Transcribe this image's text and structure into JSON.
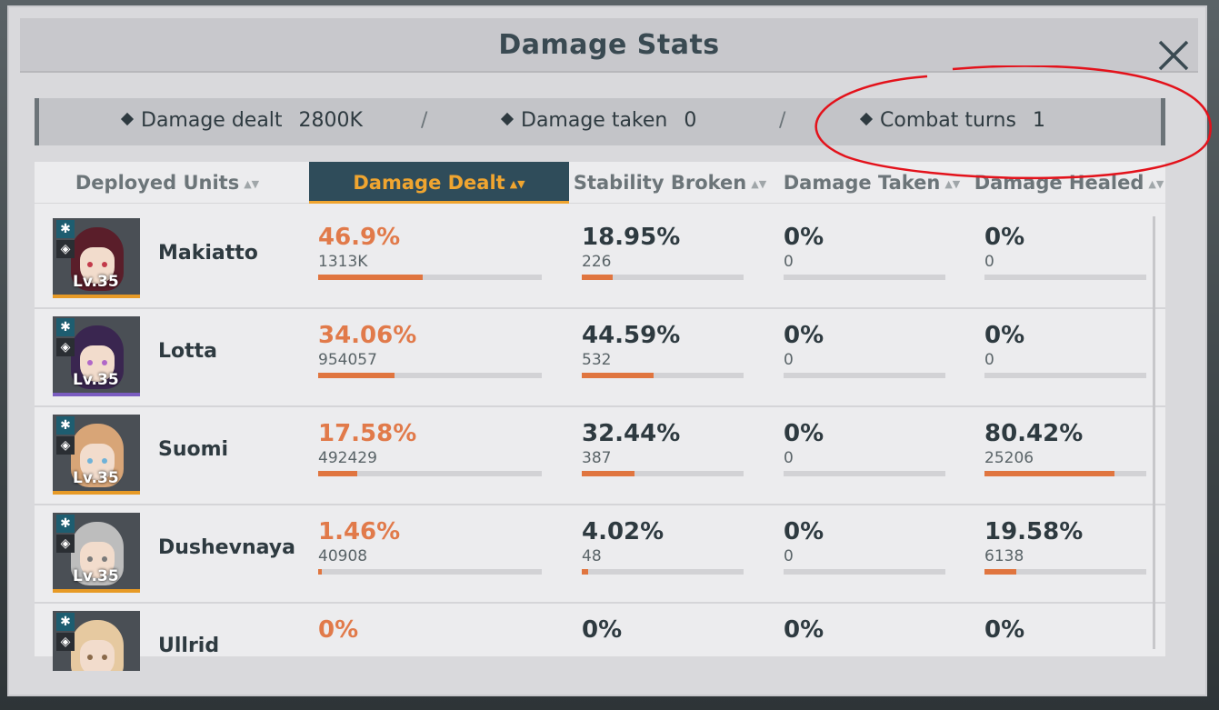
{
  "window": {
    "title": "Damage Stats",
    "close_icon": "close-icon"
  },
  "summary": {
    "items": [
      {
        "label": "Damage dealt",
        "value": "2800K"
      },
      {
        "label": "Damage taken",
        "value": "0"
      },
      {
        "label": "Combat turns",
        "value": "1"
      }
    ],
    "separator": "/"
  },
  "table": {
    "columns": [
      {
        "label": "Deployed Units",
        "active": false
      },
      {
        "label": "Damage Dealt",
        "active": true
      },
      {
        "label": "Stability Broken",
        "active": false
      },
      {
        "label": "Damage Taken",
        "active": false
      },
      {
        "label": "Damage Healed",
        "active": false
      }
    ],
    "rows": [
      {
        "name": "Makiatto",
        "level": "Lv.35",
        "dealt": {
          "pct": "46.9%",
          "raw": "1313K",
          "ratio": 0.469
        },
        "stability": {
          "pct": "18.95%",
          "raw": "226",
          "ratio": 0.1895
        },
        "taken": {
          "pct": "0%",
          "raw": "0",
          "ratio": 0
        },
        "healed": {
          "pct": "0%",
          "raw": "0",
          "ratio": 0
        }
      },
      {
        "name": "Lotta",
        "level": "Lv.35",
        "dealt": {
          "pct": "34.06%",
          "raw": "954057",
          "ratio": 0.3406
        },
        "stability": {
          "pct": "44.59%",
          "raw": "532",
          "ratio": 0.4459
        },
        "taken": {
          "pct": "0%",
          "raw": "0",
          "ratio": 0
        },
        "healed": {
          "pct": "0%",
          "raw": "0",
          "ratio": 0
        }
      },
      {
        "name": "Suomi",
        "level": "Lv.35",
        "dealt": {
          "pct": "17.58%",
          "raw": "492429",
          "ratio": 0.1758
        },
        "stability": {
          "pct": "32.44%",
          "raw": "387",
          "ratio": 0.3244
        },
        "taken": {
          "pct": "0%",
          "raw": "0",
          "ratio": 0
        },
        "healed": {
          "pct": "80.42%",
          "raw": "25206",
          "ratio": 0.8042
        }
      },
      {
        "name": "Dushevnaya",
        "level": "Lv.35",
        "dealt": {
          "pct": "1.46%",
          "raw": "40908",
          "ratio": 0.0146
        },
        "stability": {
          "pct": "4.02%",
          "raw": "48",
          "ratio": 0.0402
        },
        "taken": {
          "pct": "0%",
          "raw": "0",
          "ratio": 0
        },
        "healed": {
          "pct": "19.58%",
          "raw": "6138",
          "ratio": 0.1958
        }
      },
      {
        "name": "Ullrid",
        "level": "",
        "dealt": {
          "pct": "0%",
          "raw": "",
          "ratio": 0
        },
        "stability": {
          "pct": "0%",
          "raw": "",
          "ratio": 0
        },
        "taken": {
          "pct": "0%",
          "raw": "",
          "ratio": 0
        },
        "healed": {
          "pct": "0%",
          "raw": "",
          "ratio": 0
        }
      }
    ]
  },
  "colors": {
    "accent": "#f0a530",
    "bar_fill": "#e0753f",
    "header_active_bg": "#2f4c5a",
    "annotation": "#e3121b"
  }
}
